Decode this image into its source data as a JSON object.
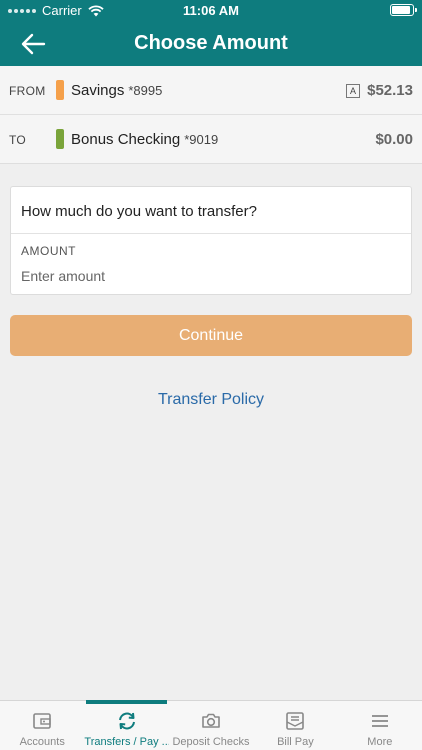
{
  "status_bar": {
    "carrier": "Carrier",
    "time": "11:06 AM",
    "battery_level": 0.9,
    "icons": [
      "signal-dots-icon",
      "wifi-icon",
      "battery-icon"
    ]
  },
  "header": {
    "title": "Choose Amount",
    "back_icon": "arrow-left-icon"
  },
  "colors": {
    "brand": "#0e7c7e",
    "savings_indicator": "#f5a04a",
    "checking_indicator": "#7aa43a",
    "continue_button": "#e8ae74",
    "link": "#2a6aa8"
  },
  "from_account": {
    "role": "FROM",
    "name": "Savings",
    "mask": "*8995",
    "badge": "A",
    "balance": "$52.13"
  },
  "to_account": {
    "role": "TO",
    "name": "Bonus Checking",
    "mask": "*9019",
    "balance": "$0.00"
  },
  "amount_form": {
    "question": "How much do you want to transfer?",
    "label": "AMOUNT",
    "placeholder": "Enter amount",
    "value": ""
  },
  "continue_label": "Continue",
  "policy_link": "Transfer Policy",
  "tabs": [
    {
      "label": "Accounts",
      "icon": "wallet-icon"
    },
    {
      "label": "Transfers / Pay ...",
      "icon": "transfer-icon",
      "active": true
    },
    {
      "label": "Deposit Checks",
      "icon": "camera-icon"
    },
    {
      "label": "Bill Pay",
      "icon": "bill-pay-icon"
    },
    {
      "label": "More",
      "icon": "menu-icon"
    }
  ]
}
